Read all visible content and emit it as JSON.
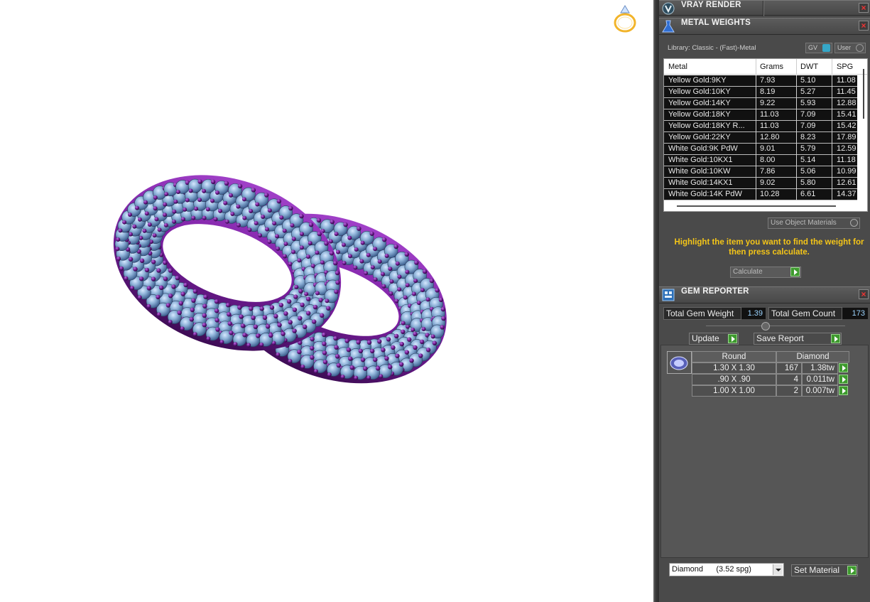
{
  "panels": {
    "vray": {
      "title": "VRAY RENDER"
    },
    "metal": {
      "title": "METAL WEIGHTS",
      "library_label": "Library: Classic - (Fast)-Metal",
      "toggle_gv": "GV",
      "toggle_user": "User",
      "columns": [
        "Metal",
        "Grams",
        "DWT",
        "SPG"
      ],
      "rows": [
        [
          "Yellow Gold:9KY",
          "7.93",
          "5.10",
          "11.08"
        ],
        [
          "Yellow Gold:10KY",
          "8.19",
          "5.27",
          "11.45"
        ],
        [
          "Yellow Gold:14KY",
          "9.22",
          "5.93",
          "12.88"
        ],
        [
          "Yellow Gold:18KY",
          "11.03",
          "7.09",
          "15.41"
        ],
        [
          "Yellow Gold:18KY R...",
          "11.03",
          "7.09",
          "15.42"
        ],
        [
          "Yellow Gold:22KY",
          "12.80",
          "8.23",
          "17.89"
        ],
        [
          "White Gold:9K PdW",
          "9.01",
          "5.79",
          "12.59"
        ],
        [
          "White Gold:10KX1",
          "8.00",
          "5.14",
          "11.18"
        ],
        [
          "White Gold:10KW",
          "7.86",
          "5.06",
          "10.99"
        ],
        [
          "White Gold:14KX1",
          "9.02",
          "5.80",
          "12.61"
        ],
        [
          "White Gold:14K PdW",
          "10.28",
          "6.61",
          "14.37"
        ]
      ],
      "use_object_materials": "Use Object Materials",
      "hint": "Highlight the item you want to find the weight for then press calculate.",
      "calculate": "Calculate"
    },
    "gem": {
      "title": "GEM REPORTER",
      "total_weight_label": "Total Gem Weight",
      "total_weight_value": "1.39",
      "total_count_label": "Total Gem Count",
      "total_count_value": "173",
      "update": "Update",
      "save_report": "Save Report",
      "shape_header": "Round",
      "material_header": "Diamond",
      "rows": [
        {
          "size": "1.30 X 1.30",
          "count": "167",
          "weight": "1.38tw"
        },
        {
          "size": ".90 X .90",
          "count": "4",
          "weight": "0.011tw"
        },
        {
          "size": "1.00 X 1.00",
          "count": "2",
          "weight": "0.007tw"
        }
      ],
      "material_select": "Diamond      (3.52 spg)",
      "set_material": "Set Material"
    }
  },
  "colors": {
    "metal": "#7b1fa2",
    "gem": "#8fb3d9",
    "panel_bg": "#4a4a4a",
    "hint": "#f4c518",
    "go_button": "#3e9a2e"
  }
}
